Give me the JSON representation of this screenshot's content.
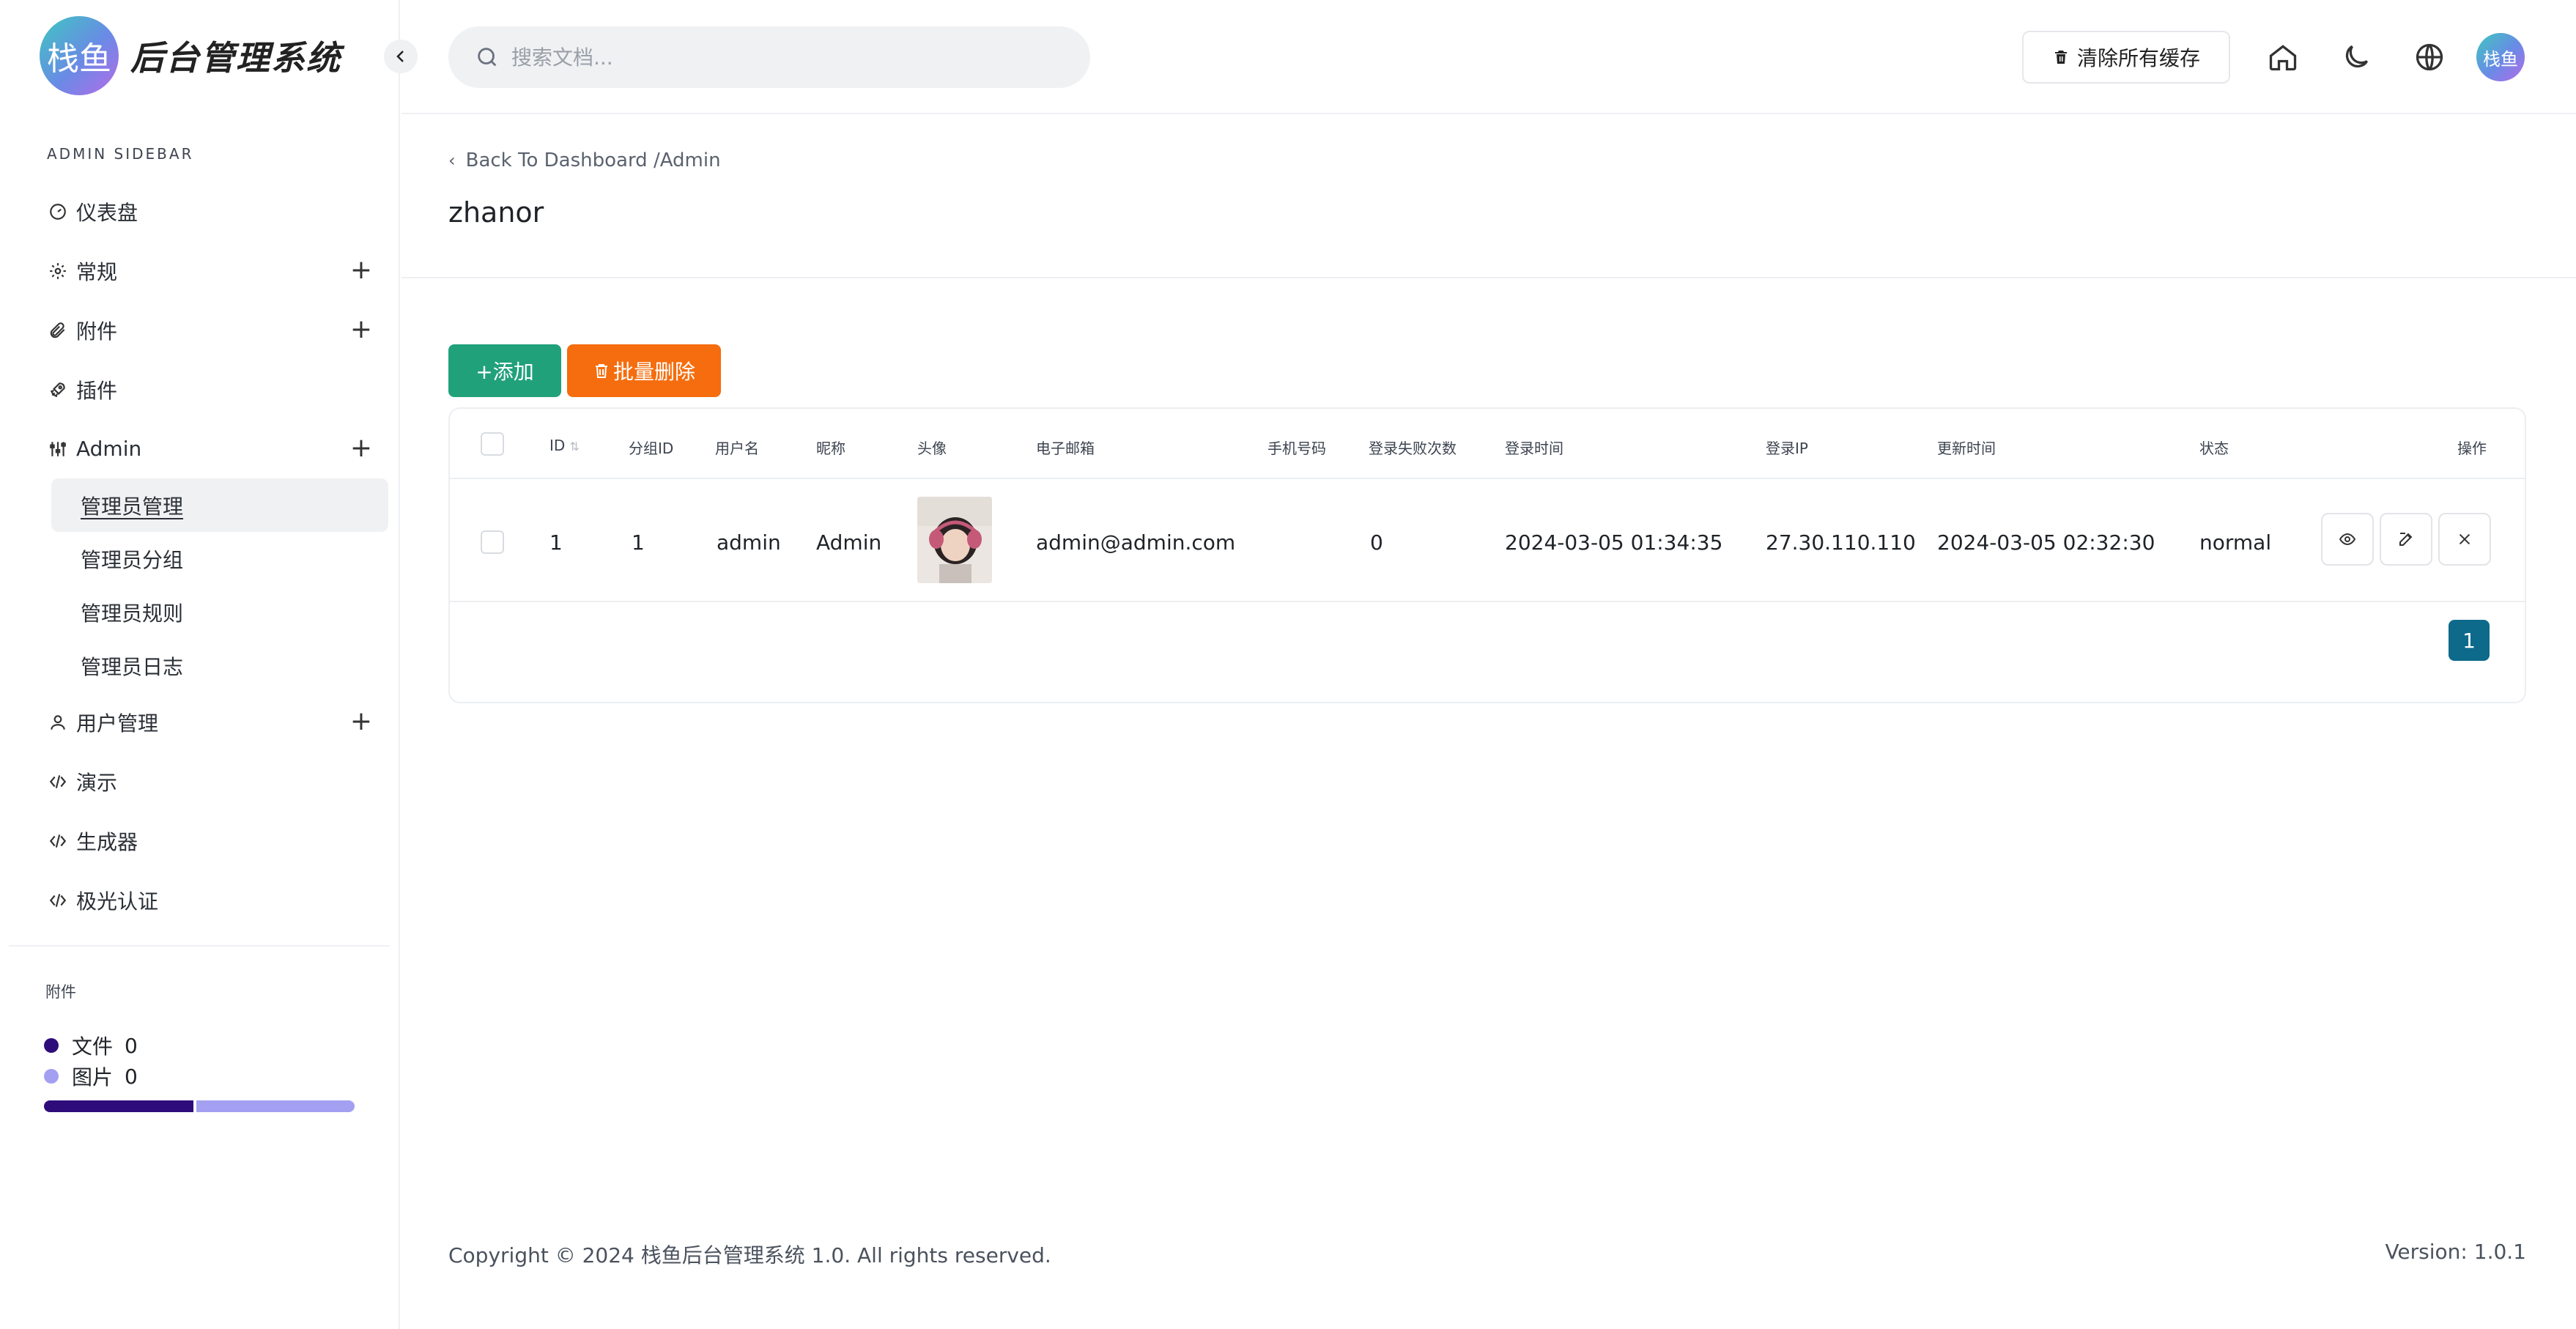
{
  "app": {
    "logo_badge": "栈鱼",
    "title": "后台管理系统"
  },
  "sidebar": {
    "heading": "ADMIN SIDEBAR",
    "items": [
      {
        "label": "仪表盘",
        "icon": "gauge-icon",
        "expandable": false
      },
      {
        "label": "常规",
        "icon": "gear-icon",
        "expandable": true
      },
      {
        "label": "附件",
        "icon": "paperclip-icon",
        "expandable": true
      },
      {
        "label": "插件",
        "icon": "rocket-icon",
        "expandable": false
      },
      {
        "label": "Admin",
        "icon": "sliders-icon",
        "expandable": true
      }
    ],
    "admin_sub": [
      {
        "label": "管理员管理",
        "active": true
      },
      {
        "label": "管理员分组",
        "active": false
      },
      {
        "label": "管理员规则",
        "active": false
      },
      {
        "label": "管理员日志",
        "active": false
      }
    ],
    "items_after": [
      {
        "label": "用户管理",
        "icon": "user-icon",
        "expandable": true
      },
      {
        "label": "演示",
        "icon": "code-icon",
        "expandable": false
      },
      {
        "label": "生成器",
        "icon": "code-icon",
        "expandable": false
      },
      {
        "label": "极光认证",
        "icon": "code-icon",
        "expandable": false
      }
    ],
    "attachments": {
      "heading": "附件",
      "files_label": "文件",
      "files_count": "0",
      "files_color": "#2e0d7a",
      "images_label": "图片",
      "images_count": "0",
      "images_color": "#a3a0f2"
    }
  },
  "topbar": {
    "search_placeholder": "搜索文档...",
    "clear_cache": "清除所有缓存",
    "avatar": "栈鱼"
  },
  "page": {
    "breadcrumb": "Back To Dashboard /Admin",
    "title": "zhanor"
  },
  "toolbar": {
    "add": "+添加",
    "batch_delete": "批量删除",
    "add_color": "#21a17a",
    "delete_color": "#f56d0e"
  },
  "table": {
    "columns": [
      "ID",
      "分组ID",
      "用户名",
      "昵称",
      "头像",
      "电子邮箱",
      "手机号码",
      "登录失败次数",
      "登录时间",
      "登录IP",
      "更新时间",
      "状态",
      "操作"
    ],
    "rows": [
      {
        "id": "1",
        "group_id": "1",
        "username": "admin",
        "nickname": "Admin",
        "email": "admin@admin.com",
        "mobile": "",
        "login_failures": "0",
        "login_time": "2024-03-05 01:34:35",
        "login_ip": "27.30.110.110",
        "update_time": "2024-03-05 02:32:30",
        "status": "normal"
      }
    ]
  },
  "pagination": {
    "current": "1"
  },
  "footer": {
    "copyright": "Copyright © 2024 栈鱼后台管理系统 1.0. All rights reserved.",
    "version": "Version: 1.0.1"
  }
}
